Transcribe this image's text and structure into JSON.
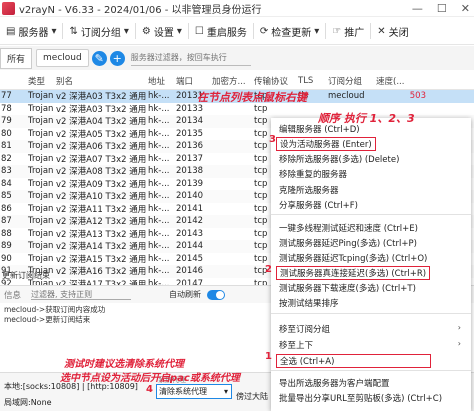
{
  "window": {
    "title": "v2rayN - V6.33 - 2024/01/06 - 以非管理员身份运行",
    "buttons": [
      "—",
      "☐",
      "✕"
    ]
  },
  "toolbar": {
    "items": [
      {
        "label": "服务器",
        "icon": "server-icon"
      },
      {
        "label": "订阅分组",
        "icon": "subscription-icon"
      },
      {
        "label": "设置",
        "icon": "gear-icon"
      },
      {
        "label": "重启服务",
        "icon": "restart-icon"
      },
      {
        "label": "检查更新",
        "icon": "update-icon"
      },
      {
        "label": "推广",
        "icon": "promote-icon"
      },
      {
        "label": "关闭",
        "icon": "close-icon"
      }
    ]
  },
  "sub_tabs": {
    "all": "所有",
    "selected": "mecloud",
    "filter_placeholder": "服务器过滤器，按回车执行"
  },
  "table": {
    "headers": [
      "",
      "类型",
      "别名",
      "地址",
      "端口",
      "加密方...",
      "传输协议",
      "TLS",
      "订阅分组",
      "速度(...",
      ""
    ],
    "rows": [
      {
        "n": "77",
        "type": "Trojan",
        "name": "v2 深港A03 T3x2 通用",
        "addr": "hk-...",
        "port": "20131",
        "enc": "",
        "proto": "tcp",
        "tls": "tls",
        "sub": "mecloud",
        "speed": "503"
      },
      {
        "n": "78",
        "type": "Trojan",
        "name": "v2 深港A03 T3x2 通用",
        "addr": "hk-...",
        "port": "20133",
        "enc": "",
        "proto": "tcp",
        "tls": "",
        "sub": "",
        "speed": ""
      },
      {
        "n": "79",
        "type": "Trojan",
        "name": "v2 深港A04 T3x2 通用",
        "addr": "hk-...",
        "port": "20134",
        "enc": "",
        "proto": "tcp",
        "tls": "",
        "sub": "",
        "speed": ""
      },
      {
        "n": "80",
        "type": "Trojan",
        "name": "v2 深港A05 T3x2 通用",
        "addr": "hk-...",
        "port": "20135",
        "enc": "",
        "proto": "tcp",
        "tls": "",
        "sub": "",
        "speed": ""
      },
      {
        "n": "81",
        "type": "Trojan",
        "name": "v2 深港A06 T3x2 通用",
        "addr": "hk-...",
        "port": "20136",
        "enc": "",
        "proto": "tcp",
        "tls": "",
        "sub": "",
        "speed": ""
      },
      {
        "n": "82",
        "type": "Trojan",
        "name": "v2 深港A07 T3x2 通用",
        "addr": "hk-...",
        "port": "20137",
        "enc": "",
        "proto": "tcp",
        "tls": "",
        "sub": "",
        "speed": ""
      },
      {
        "n": "83",
        "type": "Trojan",
        "name": "v2 深港A08 T3x2 通用",
        "addr": "hk-...",
        "port": "20138",
        "enc": "",
        "proto": "tcp",
        "tls": "",
        "sub": "",
        "speed": ""
      },
      {
        "n": "84",
        "type": "Trojan",
        "name": "v2 深港A09 T3x2 通用",
        "addr": "hk-...",
        "port": "20139",
        "enc": "",
        "proto": "tcp",
        "tls": "",
        "sub": "",
        "speed": ""
      },
      {
        "n": "85",
        "type": "Trojan",
        "name": "v2 深港A10 T3x2 通用",
        "addr": "hk-...",
        "port": "20140",
        "enc": "",
        "proto": "tcp",
        "tls": "",
        "sub": "",
        "speed": ""
      },
      {
        "n": "86",
        "type": "Trojan",
        "name": "v2 深港A11 T3x2 通用",
        "addr": "hk-...",
        "port": "20141",
        "enc": "",
        "proto": "tcp",
        "tls": "",
        "sub": "",
        "speed": ""
      },
      {
        "n": "87",
        "type": "Trojan",
        "name": "v2 深港A12 T3x2 通用",
        "addr": "hk-...",
        "port": "20142",
        "enc": "",
        "proto": "tcp",
        "tls": "",
        "sub": "",
        "speed": ""
      },
      {
        "n": "88",
        "type": "Trojan",
        "name": "v2 深港A13 T3x2 通用",
        "addr": "hk-...",
        "port": "20143",
        "enc": "",
        "proto": "tcp",
        "tls": "",
        "sub": "",
        "speed": ""
      },
      {
        "n": "89",
        "type": "Trojan",
        "name": "v2 深港A14 T3x2 通用",
        "addr": "hk-...",
        "port": "20144",
        "enc": "",
        "proto": "tcp",
        "tls": "",
        "sub": "",
        "speed": ""
      },
      {
        "n": "90",
        "type": "Trojan",
        "name": "v2 深港A15 T3x2 通用",
        "addr": "hk-...",
        "port": "20145",
        "enc": "",
        "proto": "tcp",
        "tls": "",
        "sub": "",
        "speed": ""
      },
      {
        "n": "91",
        "type": "Trojan",
        "name": "v2 深港A16 T3x2 通用",
        "addr": "hk-...",
        "port": "20146",
        "enc": "",
        "proto": "tcp",
        "tls": "",
        "sub": "",
        "speed": ""
      },
      {
        "n": "92",
        "type": "Trojan",
        "name": "v2 深港A17 T3x2 通用",
        "addr": "hk-...",
        "port": "20147",
        "enc": "",
        "proto": "tcp",
        "tls": "",
        "sub": "",
        "speed": ""
      }
    ]
  },
  "update_status": "更新订阅结束",
  "log": {
    "label": "信息",
    "filter_placeholder": "过滤器, 支持正则",
    "auto_refresh": "自动刷新",
    "lines": [
      "mecloud->获取订阅内容成功",
      "mecloud->更新订阅结束"
    ]
  },
  "status_bar": {
    "local": "本地:[socks:10808] | [http:10809]",
    "lan": "局域网:None",
    "proxy_label": "系统代理",
    "proxy_value": "清除系统代理",
    "right": "傍过大陆"
  },
  "context_menu": {
    "items": [
      "编辑服务器 (Ctrl+D)",
      "设为活动服务器 (Enter)",
      "移除所选服务器(多选) (Delete)",
      "移除重复的服务器",
      "克隆所选服务器",
      "分享服务器 (Ctrl+F)",
      "一键多线程测试延迟和速度 (Ctrl+E)",
      "测试服务器延迟Ping(多选) (Ctrl+P)",
      "测试服务器延迟Tcping(多选) (Ctrl+O)",
      "测试服务器真连接延迟(多选) (Ctrl+R)",
      "测试服务器下载速度(多选) (Ctrl+T)",
      "按测试结果排序",
      "移至订阅分组",
      "移至上下",
      "全选 (Ctrl+A)",
      "导出所选服务器为客户端配置",
      "批量导出分享URL至剪贴板(多选) (Ctrl+C)"
    ]
  },
  "annotations": {
    "right_click": "在节点列表点鼠标右键",
    "order": "顺序 执行 1、2、3",
    "n1": "1",
    "n2": "2",
    "n3": "3",
    "n4": "4",
    "tip1": "测试时建议选清除系统代理",
    "tip2": "选中节点设为活动后开启pac或系统代理"
  },
  "colors": {
    "accent": "#1e88e5",
    "annotation": "#e0223a",
    "selected_row": "#c5e0f7"
  }
}
